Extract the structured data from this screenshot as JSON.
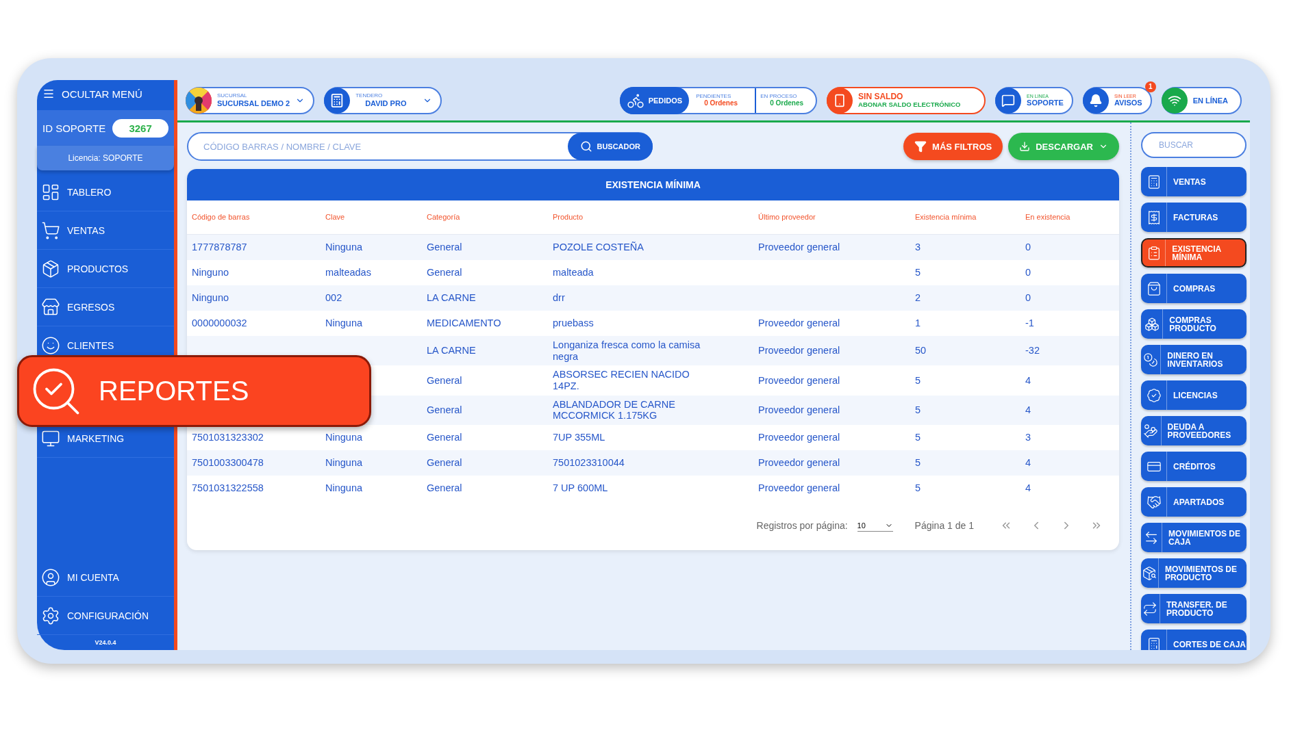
{
  "sidebar": {
    "toggle": "OCULTAR MENÚ",
    "support_id_label": "ID SOPORTE",
    "support_id": "3267",
    "license": "Licencia: SOPORTE",
    "items": [
      {
        "label": "TABLERO"
      },
      {
        "label": "VENTAS"
      },
      {
        "label": "PRODUCTOS"
      },
      {
        "label": "EGRESOS"
      },
      {
        "label": "CLIENTES"
      },
      {
        "label": "MARKETING"
      }
    ],
    "bottom_items": [
      {
        "label": "MI CUENTA"
      },
      {
        "label": "CONFIGURACIÓN"
      }
    ],
    "version": "V24.0.4"
  },
  "top_bar": {
    "branch": {
      "caption": "SUCURSAL",
      "value": "SUCURSAL DEMO 2"
    },
    "clerk": {
      "caption": "TENDERO",
      "value": "DAVID PRO"
    },
    "orders": {
      "label": "PEDIDOS",
      "pending_caption": "PENDIENTES",
      "pending": "0 Ordenes",
      "in_process_caption": "EN PROCESO",
      "in_process": "0 Ordenes"
    },
    "balance": {
      "title": "SIN SALDO",
      "action": "ABONAR SALDO ELECTRÓNICO"
    },
    "support": {
      "caption": "EN LINEA",
      "label": "SOPORTE"
    },
    "notices": {
      "caption": "SIN LEER",
      "label": "AVISOS",
      "badge": "1"
    },
    "status": {
      "label": "EN LÍNEA"
    }
  },
  "search": {
    "placeholder": "CÓDIGO BARRAS / NOMBRE / CLAVE",
    "button": "BUSCADOR"
  },
  "actions": {
    "filters": "MÁS FILTROS",
    "download": "DESCARGAR"
  },
  "table": {
    "title": "EXISTENCIA MÍNIMA",
    "columns": [
      "Código de barras",
      "Clave",
      "Categoría",
      "Producto",
      "Último proveedor",
      "Existencia mínima",
      "En existencia"
    ],
    "rows": [
      [
        "1777878787",
        "Ninguna",
        "General",
        "POZOLE COSTEÑA",
        "Proveedor general",
        "3",
        "0"
      ],
      [
        "Ninguno",
        "malteadas",
        "General",
        "malteada",
        "",
        "5",
        "0"
      ],
      [
        "Ninguno",
        "002",
        "LA CARNE",
        "drr",
        "",
        "2",
        "0"
      ],
      [
        "0000000032",
        "Ninguna",
        "MEDICAMENTO",
        "pruebass",
        "Proveedor general",
        "1",
        "-1"
      ],
      [
        "",
        "",
        "LA CARNE",
        "Longaniza fresca como la camisa negra",
        "Proveedor general",
        "50",
        "-32"
      ],
      [
        "",
        "",
        "General",
        "ABSORSEC RECIEN NACIDO 14PZ.",
        "Proveedor general",
        "5",
        "4"
      ],
      [
        "",
        "",
        "General",
        "ABLANDADOR DE CARNE MCCORMICK 1.175KG",
        "Proveedor general",
        "5",
        "4"
      ],
      [
        "7501031323302",
        "Ninguna",
        "General",
        "7UP 355ML",
        "Proveedor general",
        "5",
        "3"
      ],
      [
        "7501003300478",
        "Ninguna",
        "General",
        "7501023310044",
        "Proveedor general",
        "5",
        "4"
      ],
      [
        "7501031322558",
        "Ninguna",
        "General",
        "7 UP 600ML",
        "Proveedor general",
        "5",
        "4"
      ]
    ],
    "pagination": {
      "per_page_label": "Registros por página:",
      "per_page": "10",
      "page": "Página 1 de 1"
    }
  },
  "reports_panel": {
    "search_placeholder": "BUSCAR",
    "items": [
      {
        "label": "VENTAS",
        "selected": false
      },
      {
        "label": "FACTURAS",
        "selected": false
      },
      {
        "label": "EXISTENCIA MÍNIMA",
        "selected": true
      },
      {
        "label": "COMPRAS",
        "selected": false
      },
      {
        "label": "COMPRAS PRODUCTO",
        "selected": false
      },
      {
        "label": "DINERO EN INVENTARIOS",
        "selected": false
      },
      {
        "label": "LICENCIAS",
        "selected": false
      },
      {
        "label": "DEUDA A PROVEEDORES",
        "selected": false
      },
      {
        "label": "CRÉDITOS",
        "selected": false
      },
      {
        "label": "APARTADOS",
        "selected": false
      },
      {
        "label": "MOVIMIENTOS DE CAJA",
        "selected": false
      },
      {
        "label": "MOVIMIENTOS DE PRODUCTO",
        "selected": false
      },
      {
        "label": "TRANSFER. DE PRODUCTO",
        "selected": false
      },
      {
        "label": "CORTES DE CAJA",
        "selected": false
      }
    ]
  },
  "callout": {
    "label": "REPORTES"
  }
}
